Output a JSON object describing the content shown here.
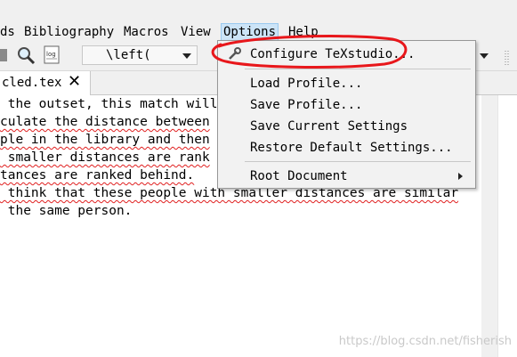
{
  "menubar": {
    "items": [
      {
        "label": "ds"
      },
      {
        "label": "Bibliography"
      },
      {
        "label": "Macros"
      },
      {
        "label": "View"
      },
      {
        "label": "Options"
      },
      {
        "label": "Help"
      }
    ]
  },
  "toolbar": {
    "combo_value": "\\left(",
    "icons": [
      "stop-icon",
      "find-icon",
      "log-icon"
    ]
  },
  "tab": {
    "label": "cled.tex",
    "close": "✕"
  },
  "editor": {
    "lines": [
      " the outset, this match will",
      "culate the distance between",
      "ple in the library and then",
      " smaller distances are rank",
      "tances are ranked behind.",
      " think that these people with smaller distances are similar",
      " the same person."
    ]
  },
  "dropdown": {
    "items": [
      {
        "label": "Configure TeXstudio..."
      },
      {
        "label": "Load Profile..."
      },
      {
        "label": "Save Profile..."
      },
      {
        "label": "Save Current Settings"
      },
      {
        "label": "Restore Default Settings..."
      },
      {
        "label": "Root Document"
      }
    ]
  },
  "watermark": "https://blog.csdn.net/fisherish",
  "colors": {
    "annotation": "#e8171b",
    "menu_highlight": "#cce4f7",
    "spell_underline": "#e02020"
  }
}
